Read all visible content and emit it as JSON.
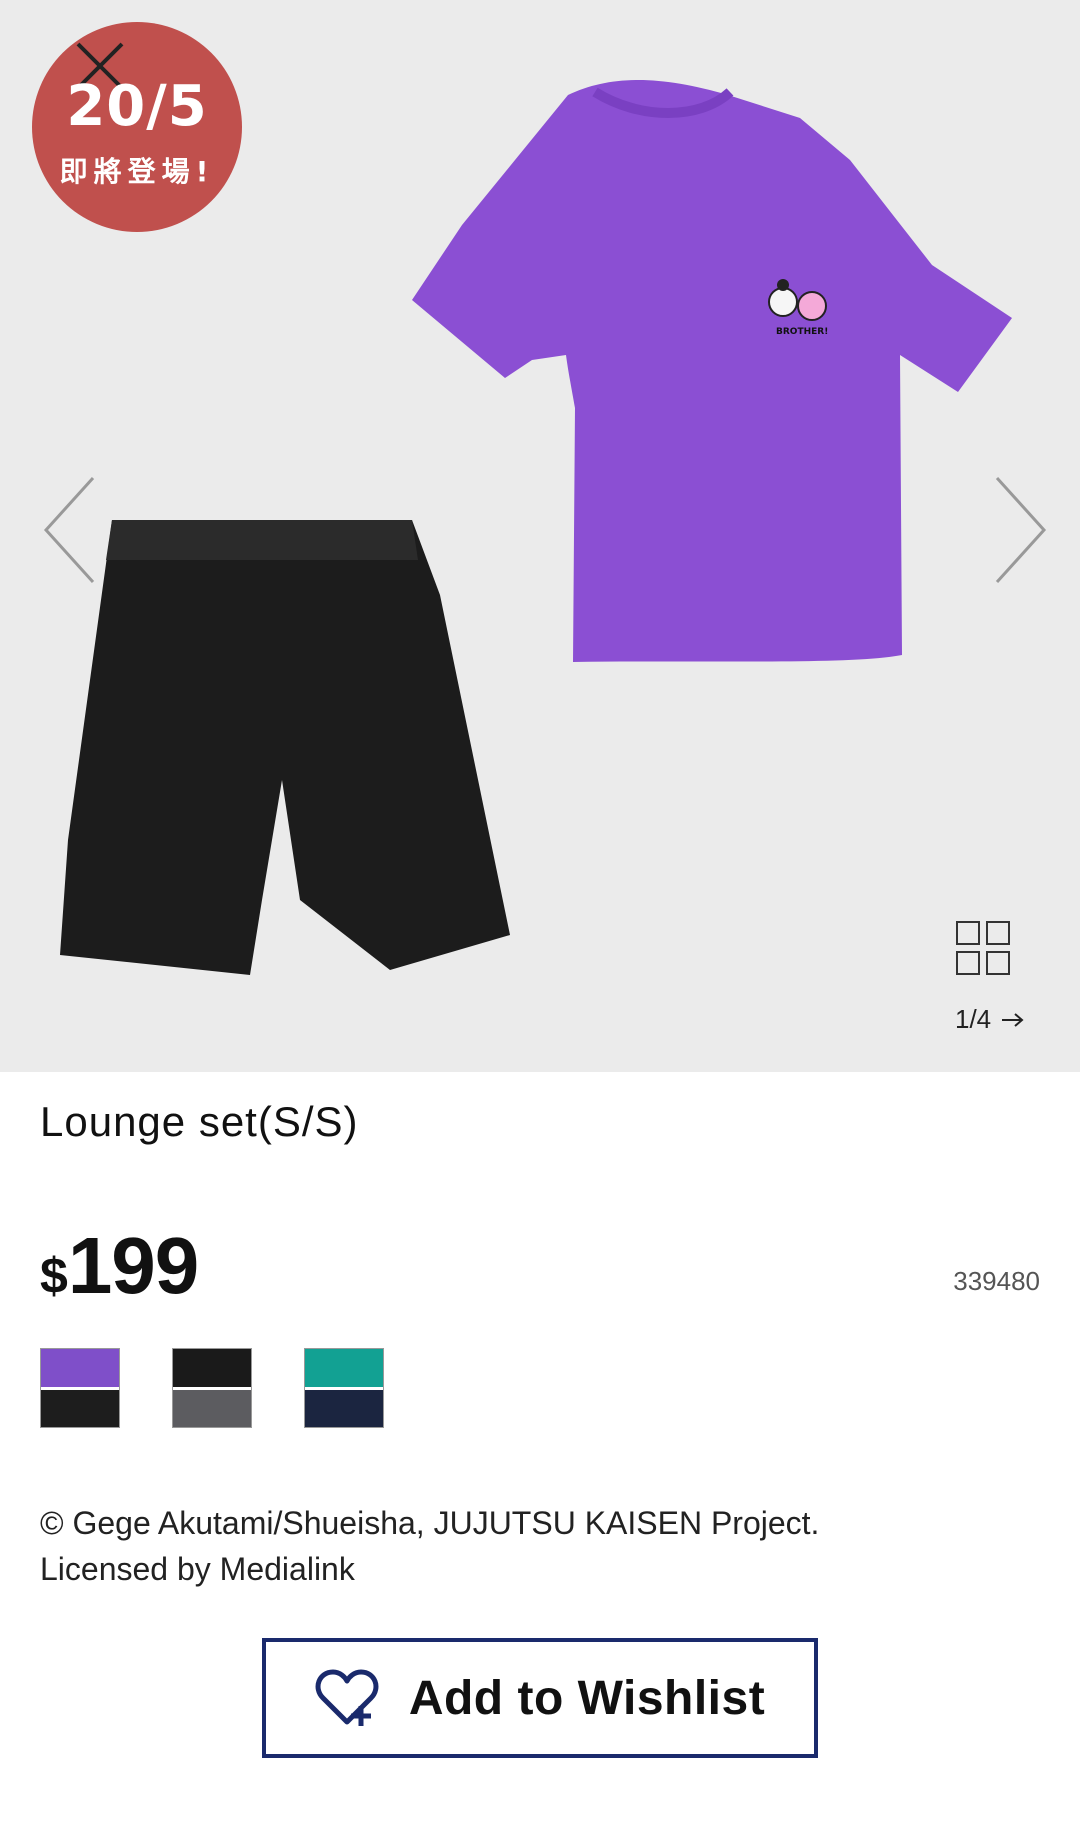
{
  "badge": {
    "date": "20/5",
    "subtitle": "即將登場!"
  },
  "gallery": {
    "counter": "1/4"
  },
  "product": {
    "title": "Lounge set(S/S)",
    "currency": "$",
    "price": "199",
    "sku": "339480",
    "embroidery_text": "BROTHER!"
  },
  "swatches": [
    {
      "top": "#7f4fc9",
      "bottom": "#1d1d1d"
    },
    {
      "top": "#1a1a1a",
      "bottom": "#5c5c60"
    },
    {
      "top": "#12a193",
      "bottom": "#1b2540"
    }
  ],
  "copyright": {
    "line1": "© Gege Akutami/Shueisha, JUJUTSU KAISEN Project.",
    "line2": "Licensed by Medialink"
  },
  "wishlist": {
    "label": "Add to Wishlist"
  },
  "colors": {
    "badge": "#c0504d",
    "accent": "#1a2a6c",
    "tshirt": "#8b4fd3",
    "shorts": "#1c1c1c"
  }
}
